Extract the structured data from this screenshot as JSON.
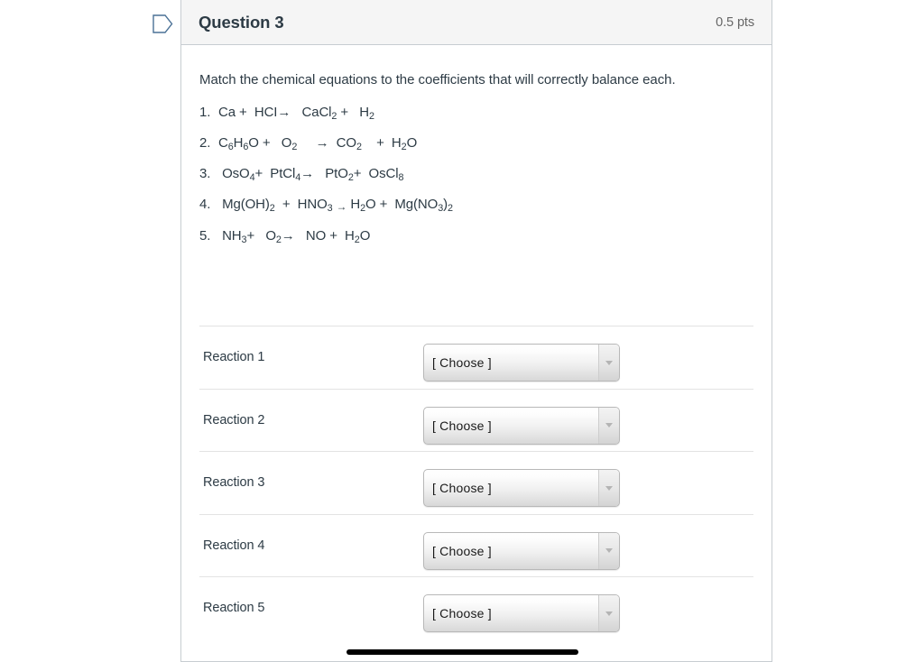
{
  "marker": {
    "icon": "tag-marker-icon",
    "color": "#4a7196"
  },
  "header": {
    "title": "Question 3",
    "points": "0.5 pts"
  },
  "body": {
    "prompt": "Match the chemical equations to the coefficients that will correctly balance each.",
    "equations": [
      {
        "number": "1.",
        "html": "Ca +  HCI→   CaCl<sub>2</sub> +   H<sub>2</sub>",
        "plain": "1. Ca + HCI → CaCl2 + H2"
      },
      {
        "number": "2.",
        "html": "C<sub>6</sub>H<sub>6</sub>O +   O<sub>2</sub>     →  CO<sub>2</sub>    +  H<sub>2</sub>O",
        "plain": "2. C6H6O + O2 → CO2 + H2O"
      },
      {
        "number": "3.",
        "html": " OsO<sub>4</sub>+  PtCl<sub>4</sub>→   PtO<sub>2</sub>+  OsCl<sub>8</sub>",
        "plain": "3. OsO4 + PtCl4 → PtO2 + OsCl8"
      },
      {
        "number": "4.",
        "html": " Mg(OH)<sub>2</sub>  +  HNO<sub>3</sub> <span class=\"arrow-small\">→</span> H<sub>2</sub>O +  Mg(NO<sub>3</sub>)<sub>2</sub>",
        "plain": "4. Mg(OH)2 + HNO3 → H2O + Mg(NO3)2"
      },
      {
        "number": "5.",
        "html": " NH<sub>3</sub>+   O<sub>2</sub>→   NO +  H<sub>2</sub>O",
        "plain": "5. NH3 + O2 → NO + H2O"
      }
    ]
  },
  "matching": {
    "rows": [
      {
        "label": "Reaction 1",
        "selected": "[ Choose ]"
      },
      {
        "label": "Reaction 2",
        "selected": "[ Choose ]"
      },
      {
        "label": "Reaction 3",
        "selected": "[ Choose ]"
      },
      {
        "label": "Reaction 4",
        "selected": "[ Choose ]"
      },
      {
        "label": "Reaction 5",
        "selected": "[ Choose ]"
      }
    ],
    "dropdown_icon": "chevron-down-icon"
  },
  "scrollbar": {
    "orientation": "horizontal",
    "thumb_color": "#000000"
  }
}
